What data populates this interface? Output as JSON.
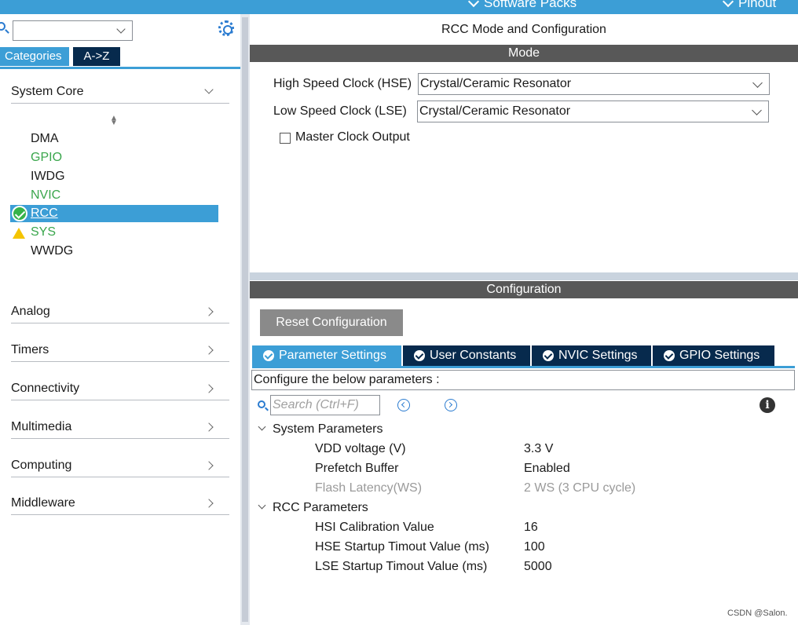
{
  "topbar": {
    "menu1": "Software Packs",
    "menu2": "Pinout"
  },
  "left": {
    "search_placeholder": "",
    "tab_categories": "Categories",
    "tab_az": "A->Z",
    "categories": {
      "system_core": "System Core",
      "analog": "Analog",
      "timers": "Timers",
      "connectivity": "Connectivity",
      "multimedia": "Multimedia",
      "computing": "Computing",
      "middleware": "Middleware"
    },
    "system_core_items": {
      "dma": "DMA",
      "gpio": "GPIO",
      "iwdg": "IWDG",
      "nvic": "NVIC",
      "rcc": "RCC",
      "sys": "SYS",
      "wwdg": "WWDG"
    }
  },
  "main": {
    "title": "RCC Mode and Configuration",
    "mode_header": "Mode",
    "hse_label": "High Speed Clock (HSE)",
    "hse_value": "Crystal/Ceramic Resonator",
    "lse_label": "Low Speed Clock (LSE)",
    "lse_value": "Crystal/Ceramic Resonator",
    "mco_label": "Master Clock Output",
    "mco_checked": false,
    "config_header": "Configuration",
    "reset_button": "Reset Configuration",
    "tabs": {
      "parameter": "Parameter Settings",
      "user": "User Constants",
      "nvic": "NVIC Settings",
      "gpio": "GPIO Settings"
    },
    "configure_text": "Configure the below parameters :",
    "search_placeholder": "Search (Ctrl+F)",
    "groups": {
      "system": "System Parameters",
      "rcc": "RCC Parameters"
    },
    "params": {
      "vdd_name": "VDD voltage (V)",
      "vdd_value": "3.3 V",
      "prefetch_name": "Prefetch Buffer",
      "prefetch_value": "Enabled",
      "flash_name": "Flash Latency(WS)",
      "flash_value": "2 WS (3 CPU cycle)",
      "hsi_name": "HSI Calibration Value",
      "hsi_value": "16",
      "hse_startup_name": "HSE Startup Timout Value (ms)",
      "hse_startup_value": "100",
      "lse_startup_name": "LSE Startup Timout Value (ms)",
      "lse_startup_value": "5000"
    }
  },
  "watermark": "CSDN @Salon.",
  "colors": {
    "accent": "#3c9ed6",
    "dark_navy": "#072a4d",
    "ok_green": "#37b34a",
    "section_bar": "#585858",
    "warn": "#f4c400"
  }
}
